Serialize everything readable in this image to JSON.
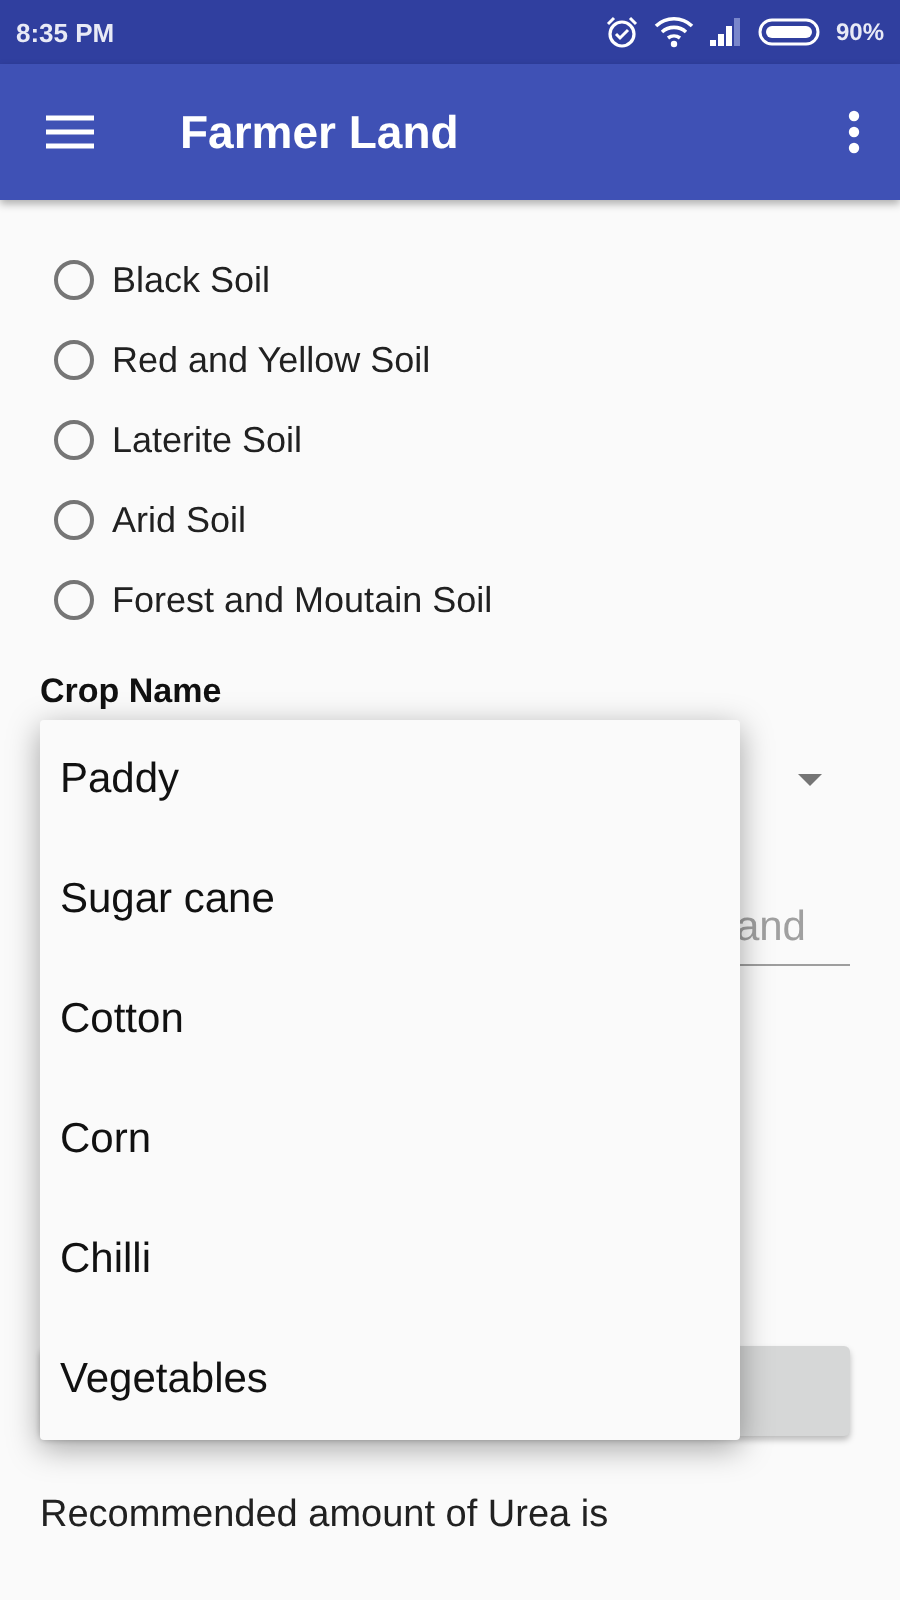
{
  "status_bar": {
    "time": "8:35 PM",
    "battery": "90%"
  },
  "app_bar": {
    "title": "Farmer Land"
  },
  "soil_types": [
    {
      "label": "Black Soil",
      "selected": false
    },
    {
      "label": "Red and Yellow Soil",
      "selected": false
    },
    {
      "label": "Laterite Soil",
      "selected": false
    },
    {
      "label": "Arid Soil",
      "selected": false
    },
    {
      "label": "Forest and Moutain Soil",
      "selected": false
    }
  ],
  "crop_label": "Crop Name",
  "land_field": {
    "placeholder": "and"
  },
  "crop_dropdown": {
    "options": [
      {
        "label": "Paddy"
      },
      {
        "label": "Sugar cane"
      },
      {
        "label": "Cotton"
      },
      {
        "label": "Corn"
      },
      {
        "label": "Chilli"
      },
      {
        "label": "Vegetables"
      }
    ]
  },
  "result_text": "Recommended amount of Urea is"
}
